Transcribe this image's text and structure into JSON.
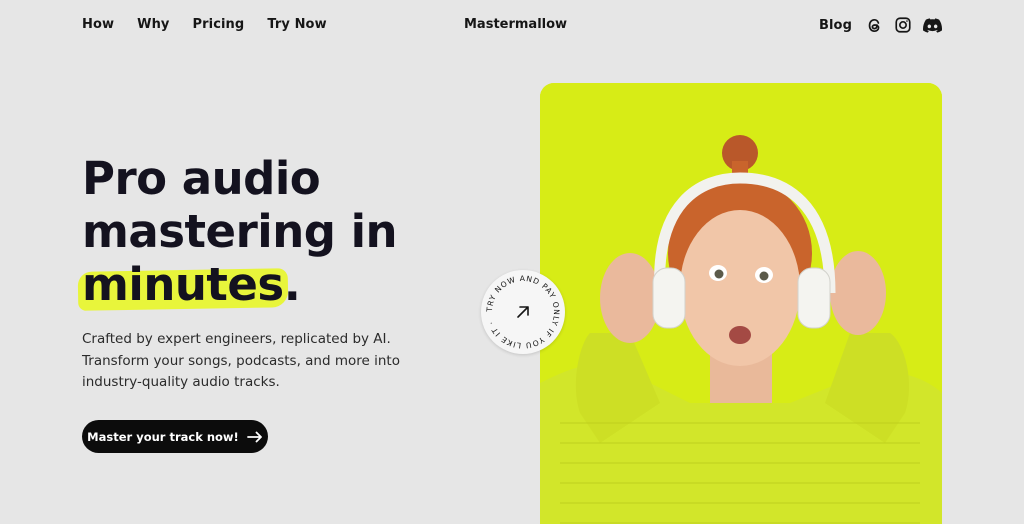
{
  "nav": {
    "links": [
      "How",
      "Why",
      "Pricing",
      "Try Now"
    ],
    "brand": "Mastermallow",
    "blog": "Blog",
    "social_icons": [
      "threads-icon",
      "instagram-icon",
      "discord-icon"
    ]
  },
  "hero": {
    "title_line1": "Pro audio",
    "title_line2": "mastering in",
    "title_highlight": "minutes",
    "title_period": ".",
    "subtitle_lines": [
      "Crafted by expert engineers, replicated by AI.",
      "Transform your songs, podcasts, and more into",
      "industry-quality audio tracks."
    ],
    "cta_label": "Master your track now!"
  },
  "badge": {
    "circular_text": "TRY NOW AND PAY ONLY IF YOU LIKE IT · "
  },
  "colors": {
    "accent_yellow": "#e8f53b",
    "photo_bg": "#d7ec16",
    "dark": "#0c0c0c",
    "page_bg": "#e6e6e6"
  }
}
